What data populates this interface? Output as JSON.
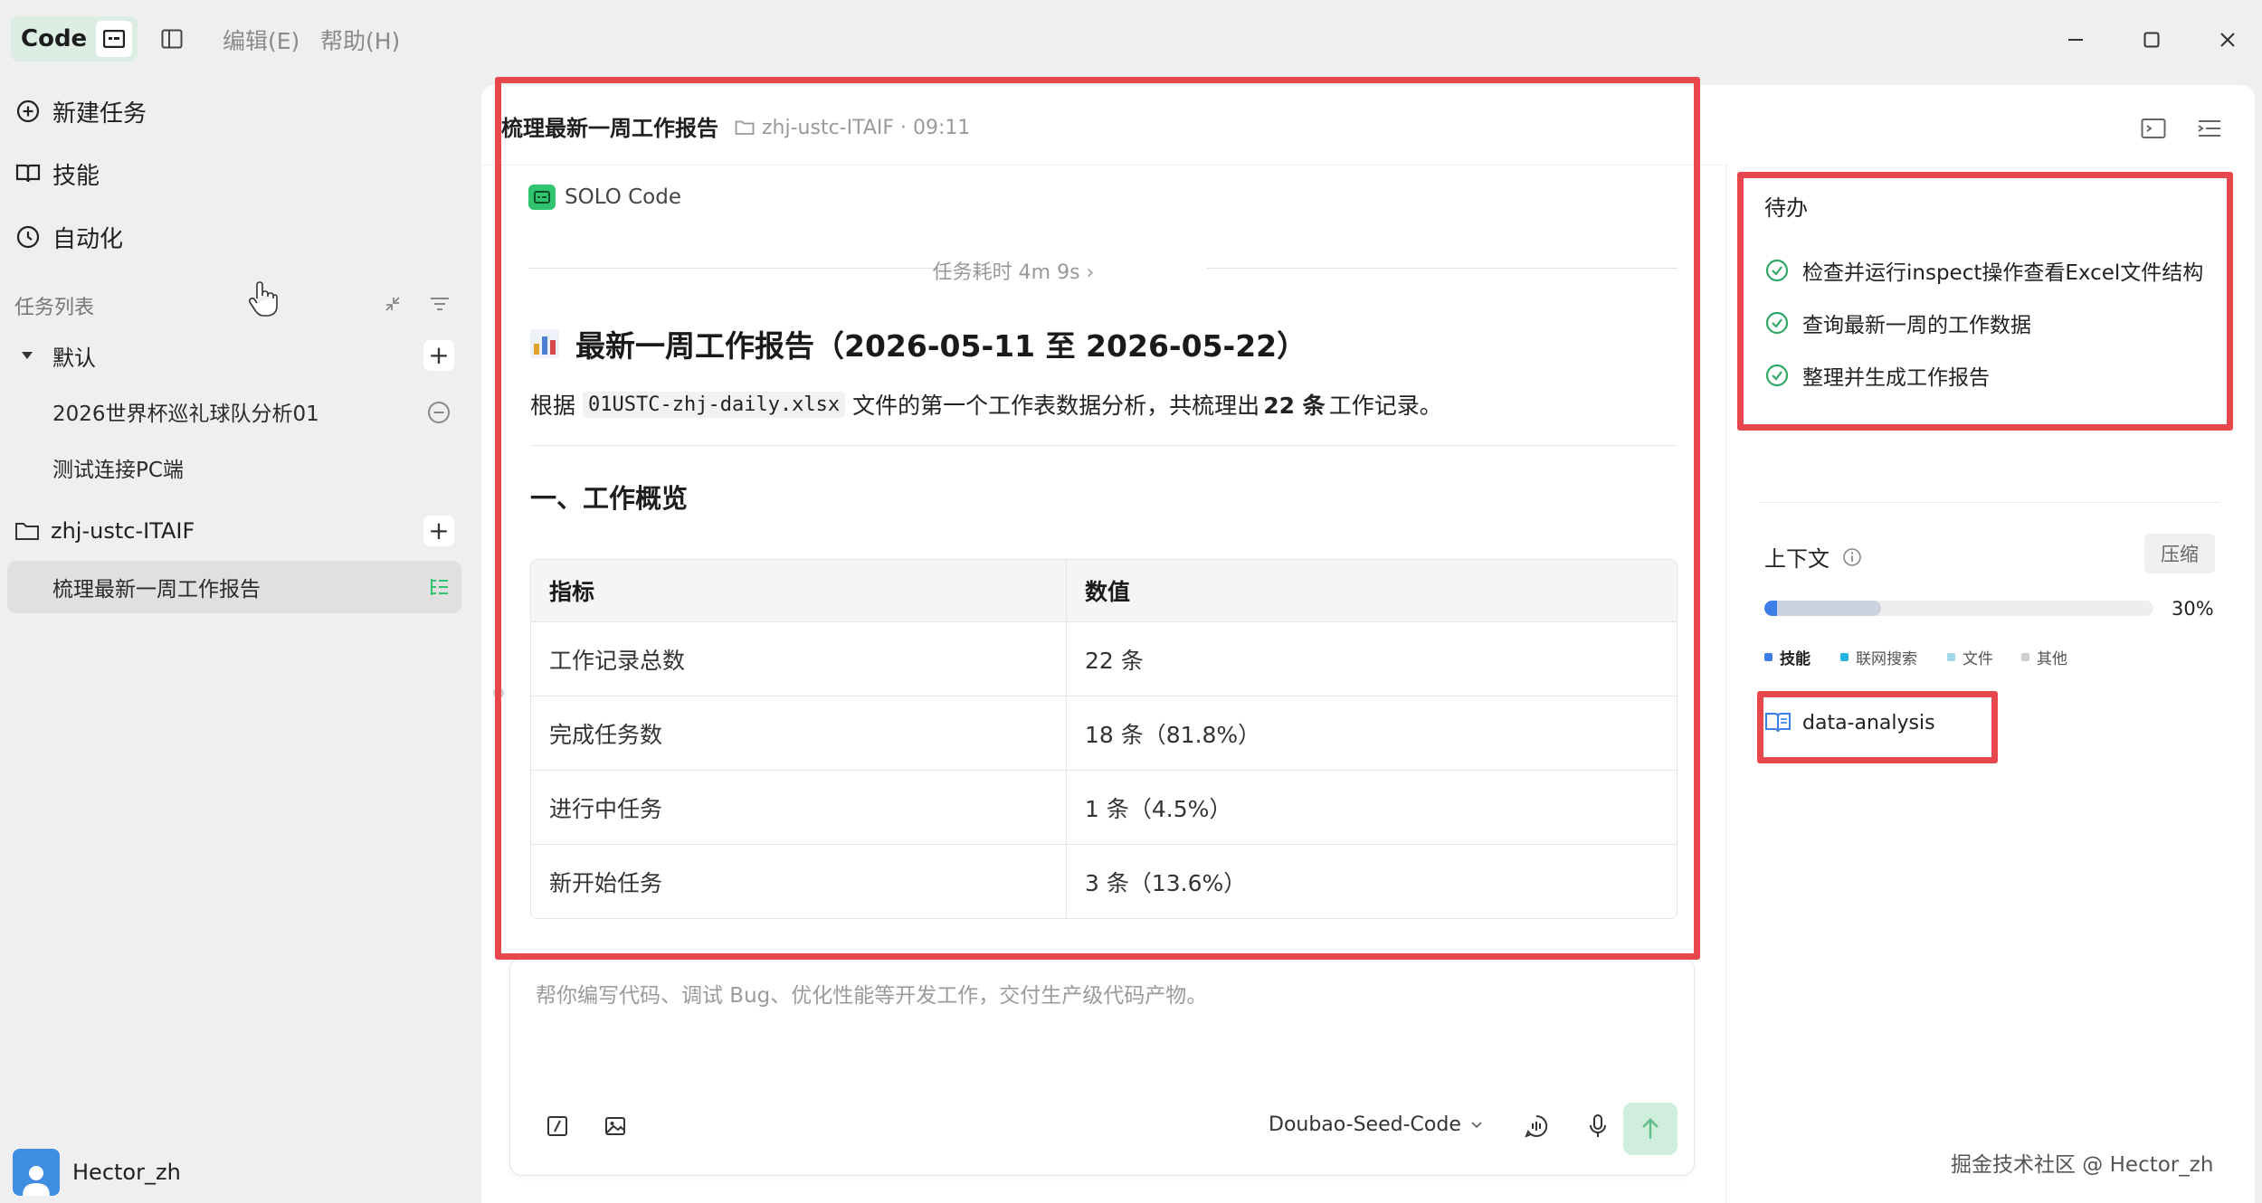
{
  "app": {
    "code_label": "Code",
    "menus": [
      "编辑(E)",
      "帮助(H)"
    ]
  },
  "sidebar": {
    "nav": [
      {
        "label": "新建任务",
        "icon": "plus-circle-icon"
      },
      {
        "label": "技能",
        "icon": "book-icon"
      },
      {
        "label": "自动化",
        "icon": "clock-icon"
      }
    ],
    "task_list_label": "任务列表",
    "groups": [
      {
        "label": "默认",
        "items": [
          "2026世界杯巡礼球队分析01",
          "测试连接PC端"
        ]
      },
      {
        "label": "zhj-ustc-ITAIF",
        "items": [
          "梳理最新一周工作报告"
        ]
      }
    ],
    "user_name": "Hector_zh"
  },
  "chat": {
    "title": "梳理最新一周工作报告",
    "meta": "zhj-ustc-ITAIF · 09:11",
    "agent": "SOLO Code",
    "duration": "任务耗时 4m 9s ›",
    "report_title": "最新一周工作报告（2026-05-11 至 2026-05-22）",
    "desc_prefix": "根据",
    "desc_file": "01USTC-zhj-daily.xlsx",
    "desc_mid": "文件的第一个工作表数据分析，共梳理出",
    "desc_count": "22 条",
    "desc_suffix": "工作记录。",
    "section_title": "一、工作概览",
    "table": {
      "headers": [
        "指标",
        "数值"
      ],
      "rows": [
        [
          "工作记录总数",
          "22 条"
        ],
        [
          "完成任务数",
          "18 条（81.8%）"
        ],
        [
          "进行中任务",
          "1 条（4.5%）"
        ],
        [
          "新开始任务",
          "3 条（13.6%）"
        ]
      ]
    }
  },
  "input": {
    "placeholder": "帮你编写代码、调试 Bug、优化性能等开发工作，交付生产级代码产物。",
    "model": "Doubao-Seed-Code"
  },
  "right_panel": {
    "todo_title": "待办",
    "todos": [
      "检查并运行inspect操作查看Excel文件结构",
      "查询最新一周的工作数据",
      "整理并生成工作报告"
    ],
    "context_title": "上下文",
    "compress_label": "压缩",
    "context_percent": 30,
    "context_percent_label": "30%",
    "legend": [
      {
        "label": "技能",
        "color": "#3b7ee8"
      },
      {
        "label": "联网搜索",
        "color": "#27b3e0"
      },
      {
        "label": "文件",
        "color": "#9fd9ea"
      },
      {
        "label": "其他",
        "color": "#cfcfcf"
      }
    ],
    "skill": "data-analysis"
  },
  "watermark": "掘金技术社区 @ Hector_zh",
  "colors": {
    "accent_green": "#2fc46d",
    "highlight_red": "#e8474e",
    "progress_blue": "#3b7ee8"
  }
}
